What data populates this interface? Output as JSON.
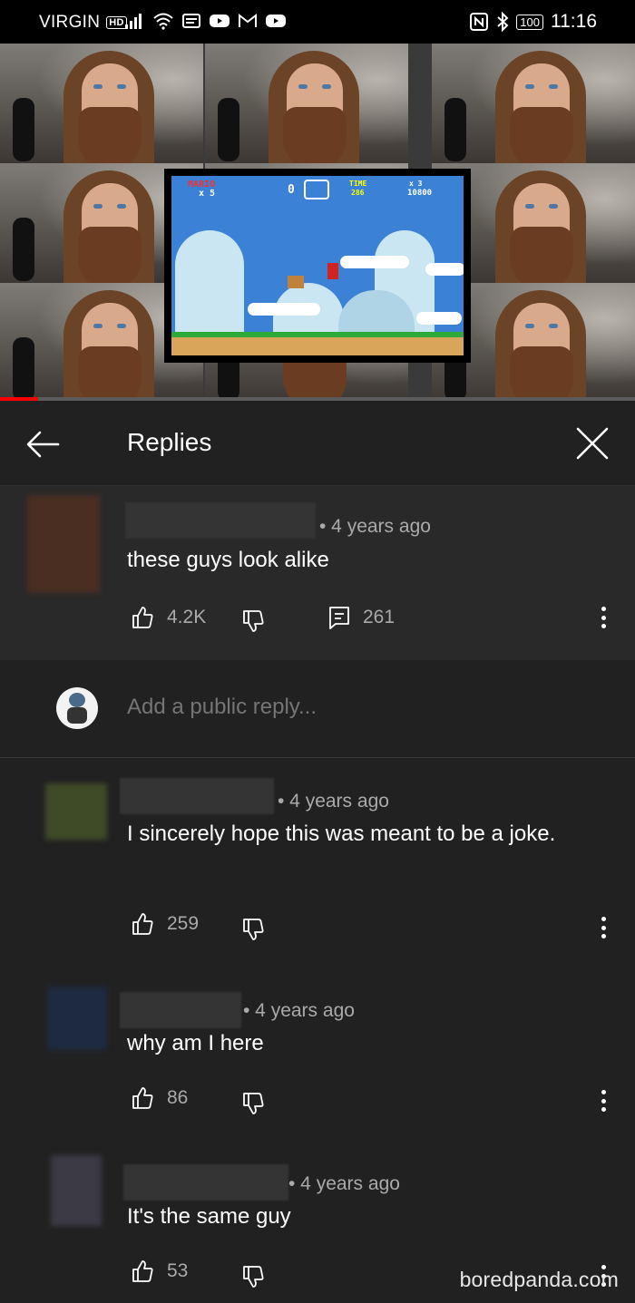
{
  "status_bar": {
    "carrier": "VIRGIN",
    "hd_badge": "HD",
    "battery": "100",
    "time": "11:16",
    "icons": [
      "signal-icon",
      "wifi-icon",
      "news-icon",
      "youtube-icon",
      "gmail-icon",
      "youtube-icon",
      "nfc-icon",
      "bluetooth-icon",
      "battery-icon"
    ]
  },
  "video": {
    "game_hud": {
      "player": "MARIO",
      "lives": "x 5",
      "coins": "0",
      "time_label": "TIME",
      "time_value": "286",
      "score": "10800",
      "coin_count": "x 3"
    },
    "progress": 0.06,
    "progress_color": "#ff0000"
  },
  "header": {
    "title": "Replies"
  },
  "original_comment": {
    "time": "• 4 years ago",
    "text": "these guys look alike",
    "likes": "4.2K",
    "replies": "261",
    "avatar_color": "#4a2e22"
  },
  "reply_box": {
    "placeholder": "Add a public reply..."
  },
  "replies": [
    {
      "time": "• 4 years ago",
      "text": "I sincerely hope this was meant to be a joke.",
      "likes": "259",
      "avatar_color": "#3f4a27"
    },
    {
      "time": "• 4 years ago",
      "text": "why am I here",
      "likes": "86",
      "avatar_color": "#1e2a40"
    },
    {
      "time": "• 4 years ago",
      "text": "It's the same guy",
      "likes": "53",
      "avatar_color": "#3b3a45"
    }
  ],
  "watermark": "boredpanda.com",
  "colors": {
    "background": "#212121",
    "original_bg": "#292929",
    "meta_text": "#aaaaaa",
    "accent_red": "#ff0000"
  }
}
